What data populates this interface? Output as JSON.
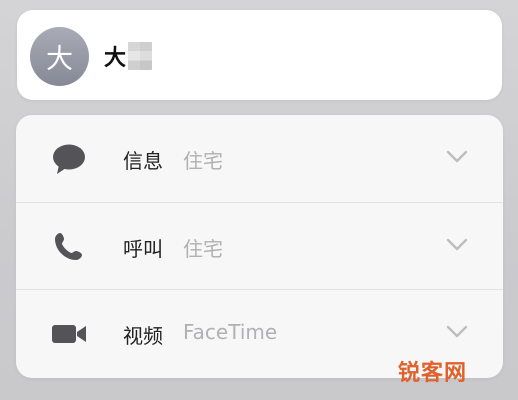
{
  "contact": {
    "avatar_initial": "大",
    "name": "大"
  },
  "actions": [
    {
      "label": "信息",
      "detail": "住宅",
      "icon": "message-bubble-icon"
    },
    {
      "label": "呼叫",
      "detail": "住宅",
      "icon": "phone-icon"
    },
    {
      "label": "视频",
      "detail": "FaceTime",
      "icon": "video-camera-icon"
    }
  ],
  "watermark": "锐客网",
  "colors": {
    "card": "#ffffff",
    "panel": "#f7f7f7",
    "label": "#222222",
    "detail": "#b1b1b4",
    "icon": "#535358",
    "chevron": "#bdbdc0",
    "watermark": "#e0612b"
  }
}
